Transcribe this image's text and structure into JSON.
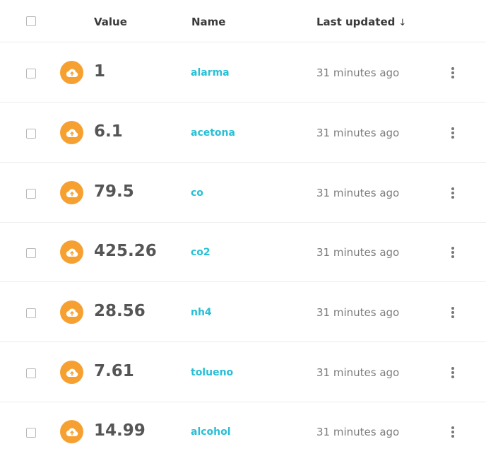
{
  "colors": {
    "icon_bg": "#f7a032",
    "name_link": "#29bfd6",
    "value_text": "#555555",
    "muted_text": "#7c7c7c"
  },
  "header": {
    "value_label": "Value",
    "name_label": "Name",
    "updated_label": "Last updated",
    "sort_indicator": "↓"
  },
  "rows": [
    {
      "icon": "cloud-upload-icon",
      "value": "1",
      "name": "alarma",
      "updated": "31 minutes ago"
    },
    {
      "icon": "cloud-upload-icon",
      "value": "6.1",
      "name": "acetona",
      "updated": "31 minutes ago"
    },
    {
      "icon": "cloud-upload-icon",
      "value": "79.5",
      "name": "co",
      "updated": "31 minutes ago"
    },
    {
      "icon": "cloud-upload-icon",
      "value": "425.26",
      "name": "co2",
      "updated": "31 minutes ago"
    },
    {
      "icon": "cloud-upload-icon",
      "value": "28.56",
      "name": "nh4",
      "updated": "31 minutes ago"
    },
    {
      "icon": "cloud-upload-icon",
      "value": "7.61",
      "name": "tolueno",
      "updated": "31 minutes ago"
    },
    {
      "icon": "cloud-upload-icon",
      "value": "14.99",
      "name": "alcohol",
      "updated": "31 minutes ago"
    }
  ]
}
